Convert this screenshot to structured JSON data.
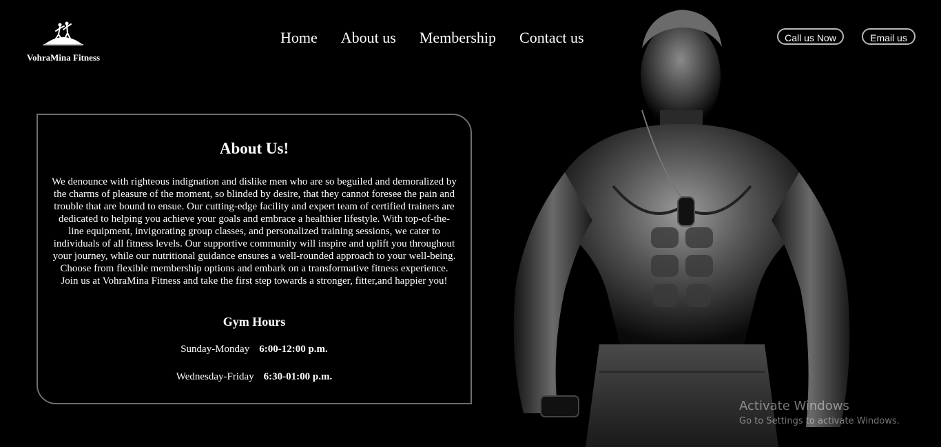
{
  "brand": {
    "name": "VohraMina Fitness",
    "logo_icon": "runner-figures-icon"
  },
  "nav": {
    "items": [
      {
        "label": "Home"
      },
      {
        "label": "About us"
      },
      {
        "label": "Membership"
      },
      {
        "label": "Contact us"
      }
    ]
  },
  "header_buttons": {
    "call_label": "Call us Now",
    "email_label": "Email us"
  },
  "about": {
    "title": "About Us!",
    "body": "We denounce with righteous indignation and dislike men who are so beguiled and demoralized by the charms of pleasure of the moment, so blinded by desire, that they cannot foresee the pain and trouble that are bound to ensue. Our cutting-edge facility and expert team of certified trainers are dedicated to helping you achieve your goals and embrace a healthier lifestyle. With top-of-the-line equipment, invigorating group classes, and personalized training sessions, we cater to individuals of all fitness levels. Our supportive community will inspire and uplift you throughout your journey, while our nutritional guidance ensures a well-rounded approach to your well-being. Choose from flexible membership options and embark on a transformative fitness experience. Join us at VohraMina Fitness and take the first step towards a stronger, fitter,and happier you!",
    "hours_title": "Gym Hours",
    "hours": [
      {
        "days": "Sunday-Monday",
        "time": "6:00-12:00 p.m."
      },
      {
        "days": "Wednesday-Friday",
        "time": "6:30-01:00 p.m."
      }
    ]
  },
  "hero_image": {
    "description_icon": "athlete-photo"
  },
  "watermark": {
    "title": "Activate Windows",
    "subtitle": "Go to Settings to activate Windows."
  },
  "colors": {
    "background": "#000000",
    "text": "#ffffff",
    "card_border": "#6e6e6e",
    "button_border": "#b8b8b8"
  }
}
